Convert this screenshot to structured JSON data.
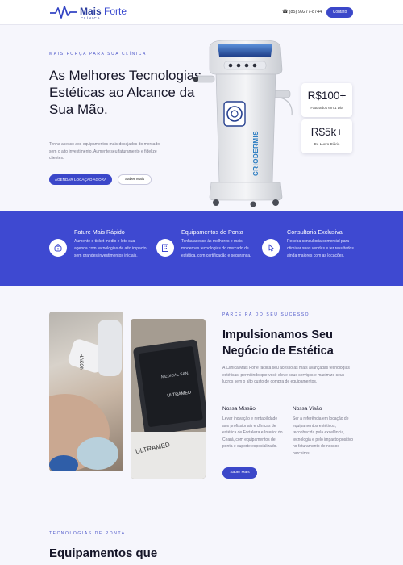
{
  "header": {
    "logo_brand_bold": "Mais",
    "logo_brand_light": "Forte",
    "logo_sub": "CLÍNICA",
    "phone": "(85) 99277-8744",
    "contact_label": "Contato"
  },
  "hero": {
    "eyebrow": "MAIS FORÇA PARA SUA CLÍNICA",
    "title": "As Melhores Tecnologias Estéticas ao Alcance da Sua Mão.",
    "description": "Tenha acesso aos equipamentos mais desejados do mercado, sem o alto investimento. Aumente seu faturamento e fidelize clientes.",
    "primary_button": "AGENDAR LOCAÇÃO AGORA",
    "secondary_button": "Saber Mais",
    "stats": [
      {
        "value": "R$100+",
        "label": "Faturados em 1 Dia"
      },
      {
        "value": "R$5k+",
        "label": "De Lucro Diário"
      }
    ]
  },
  "features": [
    {
      "icon": "piggy-bank-icon",
      "title": "Fature Mais Rápido",
      "description": "Aumente o ticket médio e lote sua agenda com tecnologias de alto impacto, sem grandes investimentos iniciais."
    },
    {
      "icon": "building-icon",
      "title": "Equipamentos de Ponta",
      "description": "Tenha acesso às melhores e mais modernas tecnologias do mercado de estética, com certificação e segurança."
    },
    {
      "icon": "pointer-icon",
      "title": "Consultoria Exclusiva",
      "description": "Receba consultoria comercial para otimizar suas vendas e ter resultados ainda maiores com as locações."
    }
  ],
  "about": {
    "eyebrow": "PARCEIRA DO SEU SUCESSO",
    "title": "Impulsionamos Seu Negócio de Estética",
    "description": "A Clínica Mais Forte facilita seu acesso às mais avançadas tecnologias estéticas, permitindo que você eleve seus serviços e maximize seus lucros sem o alto custo de compra de equipamentos.",
    "mission_title": "Nossa Missão",
    "mission_text": "Levar inovação e rentabilidade aos profissionais e clínicas de estética de Fortaleza e Interior do Ceará, com equipamentos de ponta e suporte especializado.",
    "vision_title": "Nossa Visão",
    "vision_text": "Ser a referência em locação de equipamentos estéticos, reconhecida pela excelência, tecnologia e pelo impacto positivo no faturamento de nossos parceiros.",
    "button": "Saber Mais"
  },
  "device_text": {
    "column_label": "CRIODERMIS"
  },
  "photos": {
    "handpiece_label": "HAKON",
    "screen_brand": "MEDICAL SAN",
    "screen_product": "ULTRAMED",
    "device_brand": "ULTRAMED"
  },
  "next_section": {
    "eyebrow": "TECNOLOGIAS DE PONTA",
    "title": "Equipamentos que"
  },
  "colors": {
    "accent": "#3b47c9",
    "band": "#3e49d1",
    "background": "#f6f6fc"
  }
}
